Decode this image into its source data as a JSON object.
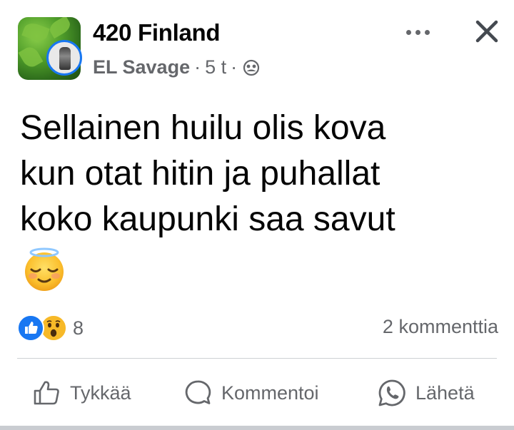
{
  "post": {
    "group_name": "420 Finland",
    "author": "EL Savage",
    "separator": "·",
    "time": "5 t",
    "audience_icon": "group-audience-icon",
    "text_lines": [
      "Sellainen huilu olis kova",
      "kun otat hitin ja puhallat",
      "koko kaupunki saa savut"
    ],
    "emoji": "smiling-face-with-halo"
  },
  "reactions": {
    "icons": [
      "like-reaction-icon",
      "wow-reaction-icon"
    ],
    "count": "8",
    "comments": "2 kommenttia"
  },
  "actions": {
    "like": "Tykkää",
    "comment": "Kommentoi",
    "share": "Lähetä"
  },
  "colors": {
    "accent": "#1877f2",
    "secondary_text": "#65676b",
    "divider": "#ced0d4"
  }
}
